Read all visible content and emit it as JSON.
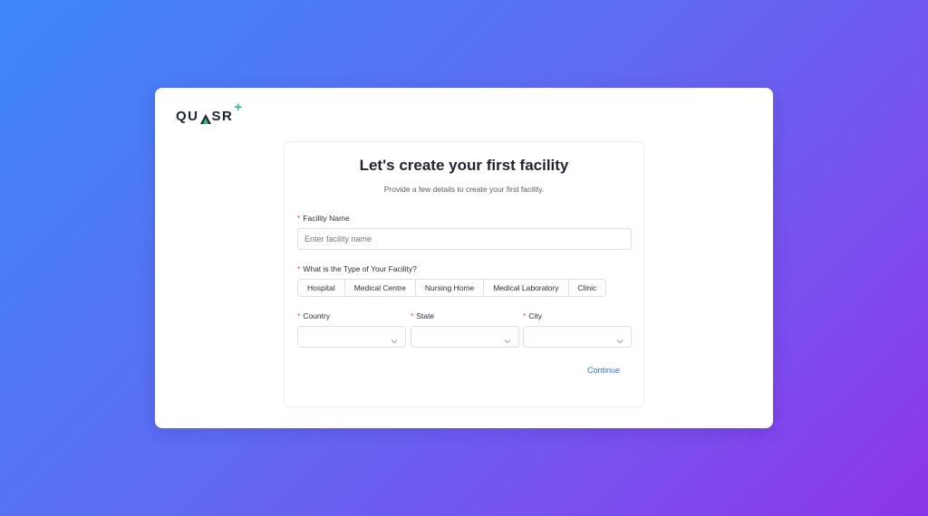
{
  "brand": {
    "name_left": "QU",
    "name_right": "SR",
    "plus": "+",
    "accent": "#2dbd8a"
  },
  "form": {
    "title": "Let's create your first facility",
    "subtitle": "Provide a few details to create your first facility.",
    "required_mark": "*",
    "facility_name": {
      "label": "Facility Name",
      "placeholder": "Enter facility name",
      "value": ""
    },
    "facility_type": {
      "label": "What is the Type of Your Facility?",
      "options": [
        "Hospital",
        "Medical Centre",
        "Nursing Home",
        "Medical Laboratory",
        "Clinic"
      ]
    },
    "country": {
      "label": "Country",
      "value": ""
    },
    "state": {
      "label": "State",
      "value": ""
    },
    "city": {
      "label": "City",
      "value": ""
    },
    "continue_label": "Continue"
  },
  "icons": {
    "logo_mark": "triangle-a-icon",
    "select_arrow": "chevron-down-icon"
  }
}
